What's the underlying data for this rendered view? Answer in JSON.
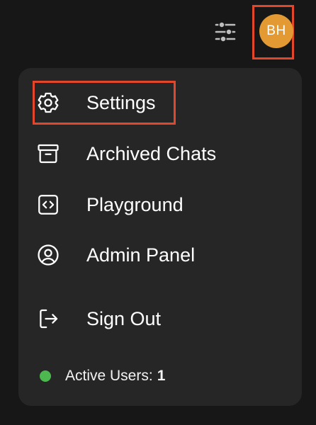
{
  "header": {
    "controls_icon": "sliders-icon",
    "avatar_initials": "BH",
    "avatar_color": "#e49a33"
  },
  "menu": {
    "items": [
      {
        "label": "Settings",
        "icon": "gear-icon"
      },
      {
        "label": "Archived Chats",
        "icon": "archive-box-icon"
      },
      {
        "label": "Playground",
        "icon": "code-brackets-icon"
      },
      {
        "label": "Admin Panel",
        "icon": "user-circle-icon"
      },
      {
        "label": "Sign Out",
        "icon": "sign-out-icon"
      }
    ],
    "active_users_label": "Active Users:",
    "active_users_count": "1",
    "status_color": "#4db84f"
  },
  "highlight_color": "#e2472b"
}
